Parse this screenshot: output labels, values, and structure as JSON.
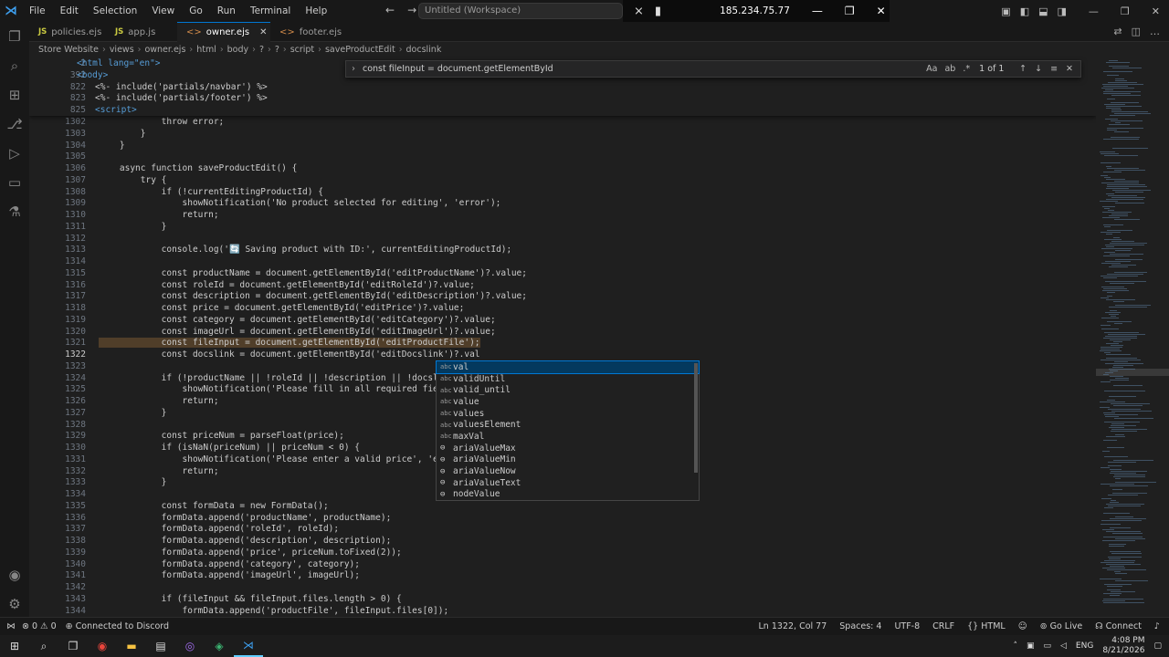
{
  "titlebar": {
    "menu": [
      "File",
      "Edit",
      "Selection",
      "View",
      "Go",
      "Run",
      "Terminal",
      "Help"
    ],
    "search_placeholder": "Untitled (Workspace)",
    "remote_ip": "185.234.75.77"
  },
  "tabs": [
    {
      "label": "policies.ejs",
      "kind": "JS"
    },
    {
      "label": "app.js",
      "kind": "JS"
    },
    {
      "label": "owner.ejs",
      "kind": "<>",
      "active": true
    },
    {
      "label": "footer.ejs",
      "kind": "<>"
    }
  ],
  "breadcrumb": [
    "Store Website",
    "views",
    "owner.ejs",
    "html",
    "body",
    "?",
    "?",
    "script",
    "saveProductEdit",
    "docslink"
  ],
  "find": {
    "query": "const fileInput = document.getElementById",
    "count": "1 of 1"
  },
  "sticky_lines": [
    {
      "n": "2",
      "text": "<html lang=\"en\">"
    },
    {
      "n": "392",
      "text": "<body>"
    },
    {
      "n": "822",
      "text": "<%- include('partials/navbar') %>"
    },
    {
      "n": "823",
      "text": "<%- include('partials/footer') %>"
    },
    {
      "n": "825",
      "text": "<script>"
    }
  ],
  "code_lines": [
    {
      "n": "1302",
      "text": "            throw error;"
    },
    {
      "n": "1303",
      "text": "        }"
    },
    {
      "n": "1304",
      "text": "    }"
    },
    {
      "n": "1305",
      "text": ""
    },
    {
      "n": "1306",
      "text": "    async function saveProductEdit() {"
    },
    {
      "n": "1307",
      "text": "        try {"
    },
    {
      "n": "1308",
      "text": "            if (!currentEditingProductId) {"
    },
    {
      "n": "1309",
      "text": "                showNotification('No product selected for editing', 'error');"
    },
    {
      "n": "1310",
      "text": "                return;"
    },
    {
      "n": "1311",
      "text": "            }"
    },
    {
      "n": "1312",
      "text": ""
    },
    {
      "n": "1313",
      "text": "            console.log('🔄 Saving product with ID:', currentEditingProductId);"
    },
    {
      "n": "1314",
      "text": ""
    },
    {
      "n": "1315",
      "text": "            const productName = document.getElementById('editProductName')?.value;"
    },
    {
      "n": "1316",
      "text": "            const roleId = document.getElementById('editRoleId')?.value;"
    },
    {
      "n": "1317",
      "text": "            const description = document.getElementById('editDescription')?.value;"
    },
    {
      "n": "1318",
      "text": "            const price = document.getElementById('editPrice')?.value;"
    },
    {
      "n": "1319",
      "text": "            const category = document.getElementById('editCategory')?.value;"
    },
    {
      "n": "1320",
      "text": "            const imageUrl = document.getElementById('editImageUrl')?.value;"
    },
    {
      "n": "1321",
      "text": "            const fileInput = document.getElementById('editProductFile');"
    },
    {
      "n": "1322",
      "text": "            const docslink = document.getElementById('editDocslink')?.val"
    },
    {
      "n": "1323",
      "text": ""
    },
    {
      "n": "1324",
      "text": "            if (!productName || !roleId || !description || !docslink || !"
    },
    {
      "n": "1325",
      "text": "                showNotification('Please fill in all required fields', 'e"
    },
    {
      "n": "1326",
      "text": "                return;"
    },
    {
      "n": "1327",
      "text": "            }"
    },
    {
      "n": "1328",
      "text": ""
    },
    {
      "n": "1329",
      "text": "            const priceNum = parseFloat(price);"
    },
    {
      "n": "1330",
      "text": "            if (isNaN(priceNum) || priceNum < 0) {"
    },
    {
      "n": "1331",
      "text": "                showNotification('Please enter a valid price', 'error');"
    },
    {
      "n": "1332",
      "text": "                return;"
    },
    {
      "n": "1333",
      "text": "            }"
    },
    {
      "n": "1334",
      "text": ""
    },
    {
      "n": "1335",
      "text": "            const formData = new FormData();"
    },
    {
      "n": "1336",
      "text": "            formData.append('productName', productName);"
    },
    {
      "n": "1337",
      "text": "            formData.append('roleId', roleId);"
    },
    {
      "n": "1338",
      "text": "            formData.append('description', description);"
    },
    {
      "n": "1339",
      "text": "            formData.append('price', priceNum.toFixed(2));"
    },
    {
      "n": "1340",
      "text": "            formData.append('category', category);"
    },
    {
      "n": "1341",
      "text": "            formData.append('imageUrl', imageUrl);"
    },
    {
      "n": "1342",
      "text": ""
    },
    {
      "n": "1343",
      "text": "            if (fileInput && fileInput.files.length > 0) {"
    },
    {
      "n": "1344",
      "text": "                formData.append('productFile', fileInput.files[0]);"
    }
  ],
  "suggestions": [
    {
      "label": "val",
      "kind": "abc"
    },
    {
      "label": "validUntil",
      "kind": "abc"
    },
    {
      "label": "valid_until",
      "kind": "abc"
    },
    {
      "label": "value",
      "kind": "abc"
    },
    {
      "label": "values",
      "kind": "abc"
    },
    {
      "label": "valuesElement",
      "kind": "abc"
    },
    {
      "label": "maxVal",
      "kind": "abc"
    },
    {
      "label": "ariaValueMax",
      "kind": "prop"
    },
    {
      "label": "ariaValueMin",
      "kind": "prop"
    },
    {
      "label": "ariaValueNow",
      "kind": "prop"
    },
    {
      "label": "ariaValueText",
      "kind": "prop"
    },
    {
      "label": "nodeValue",
      "kind": "prop"
    }
  ],
  "status": {
    "errors": "0",
    "warnings": "0",
    "discord": "Connected to Discord",
    "position": "Ln 1322, Col 77",
    "spaces": "Spaces: 4",
    "encoding": "UTF-8",
    "eol": "CRLF",
    "language": "HTML",
    "golive": "Go Live",
    "connect": "Connect"
  },
  "taskbar": {
    "lang": "ENG",
    "time": "4:08 PM",
    "date": "8/21/2026"
  }
}
